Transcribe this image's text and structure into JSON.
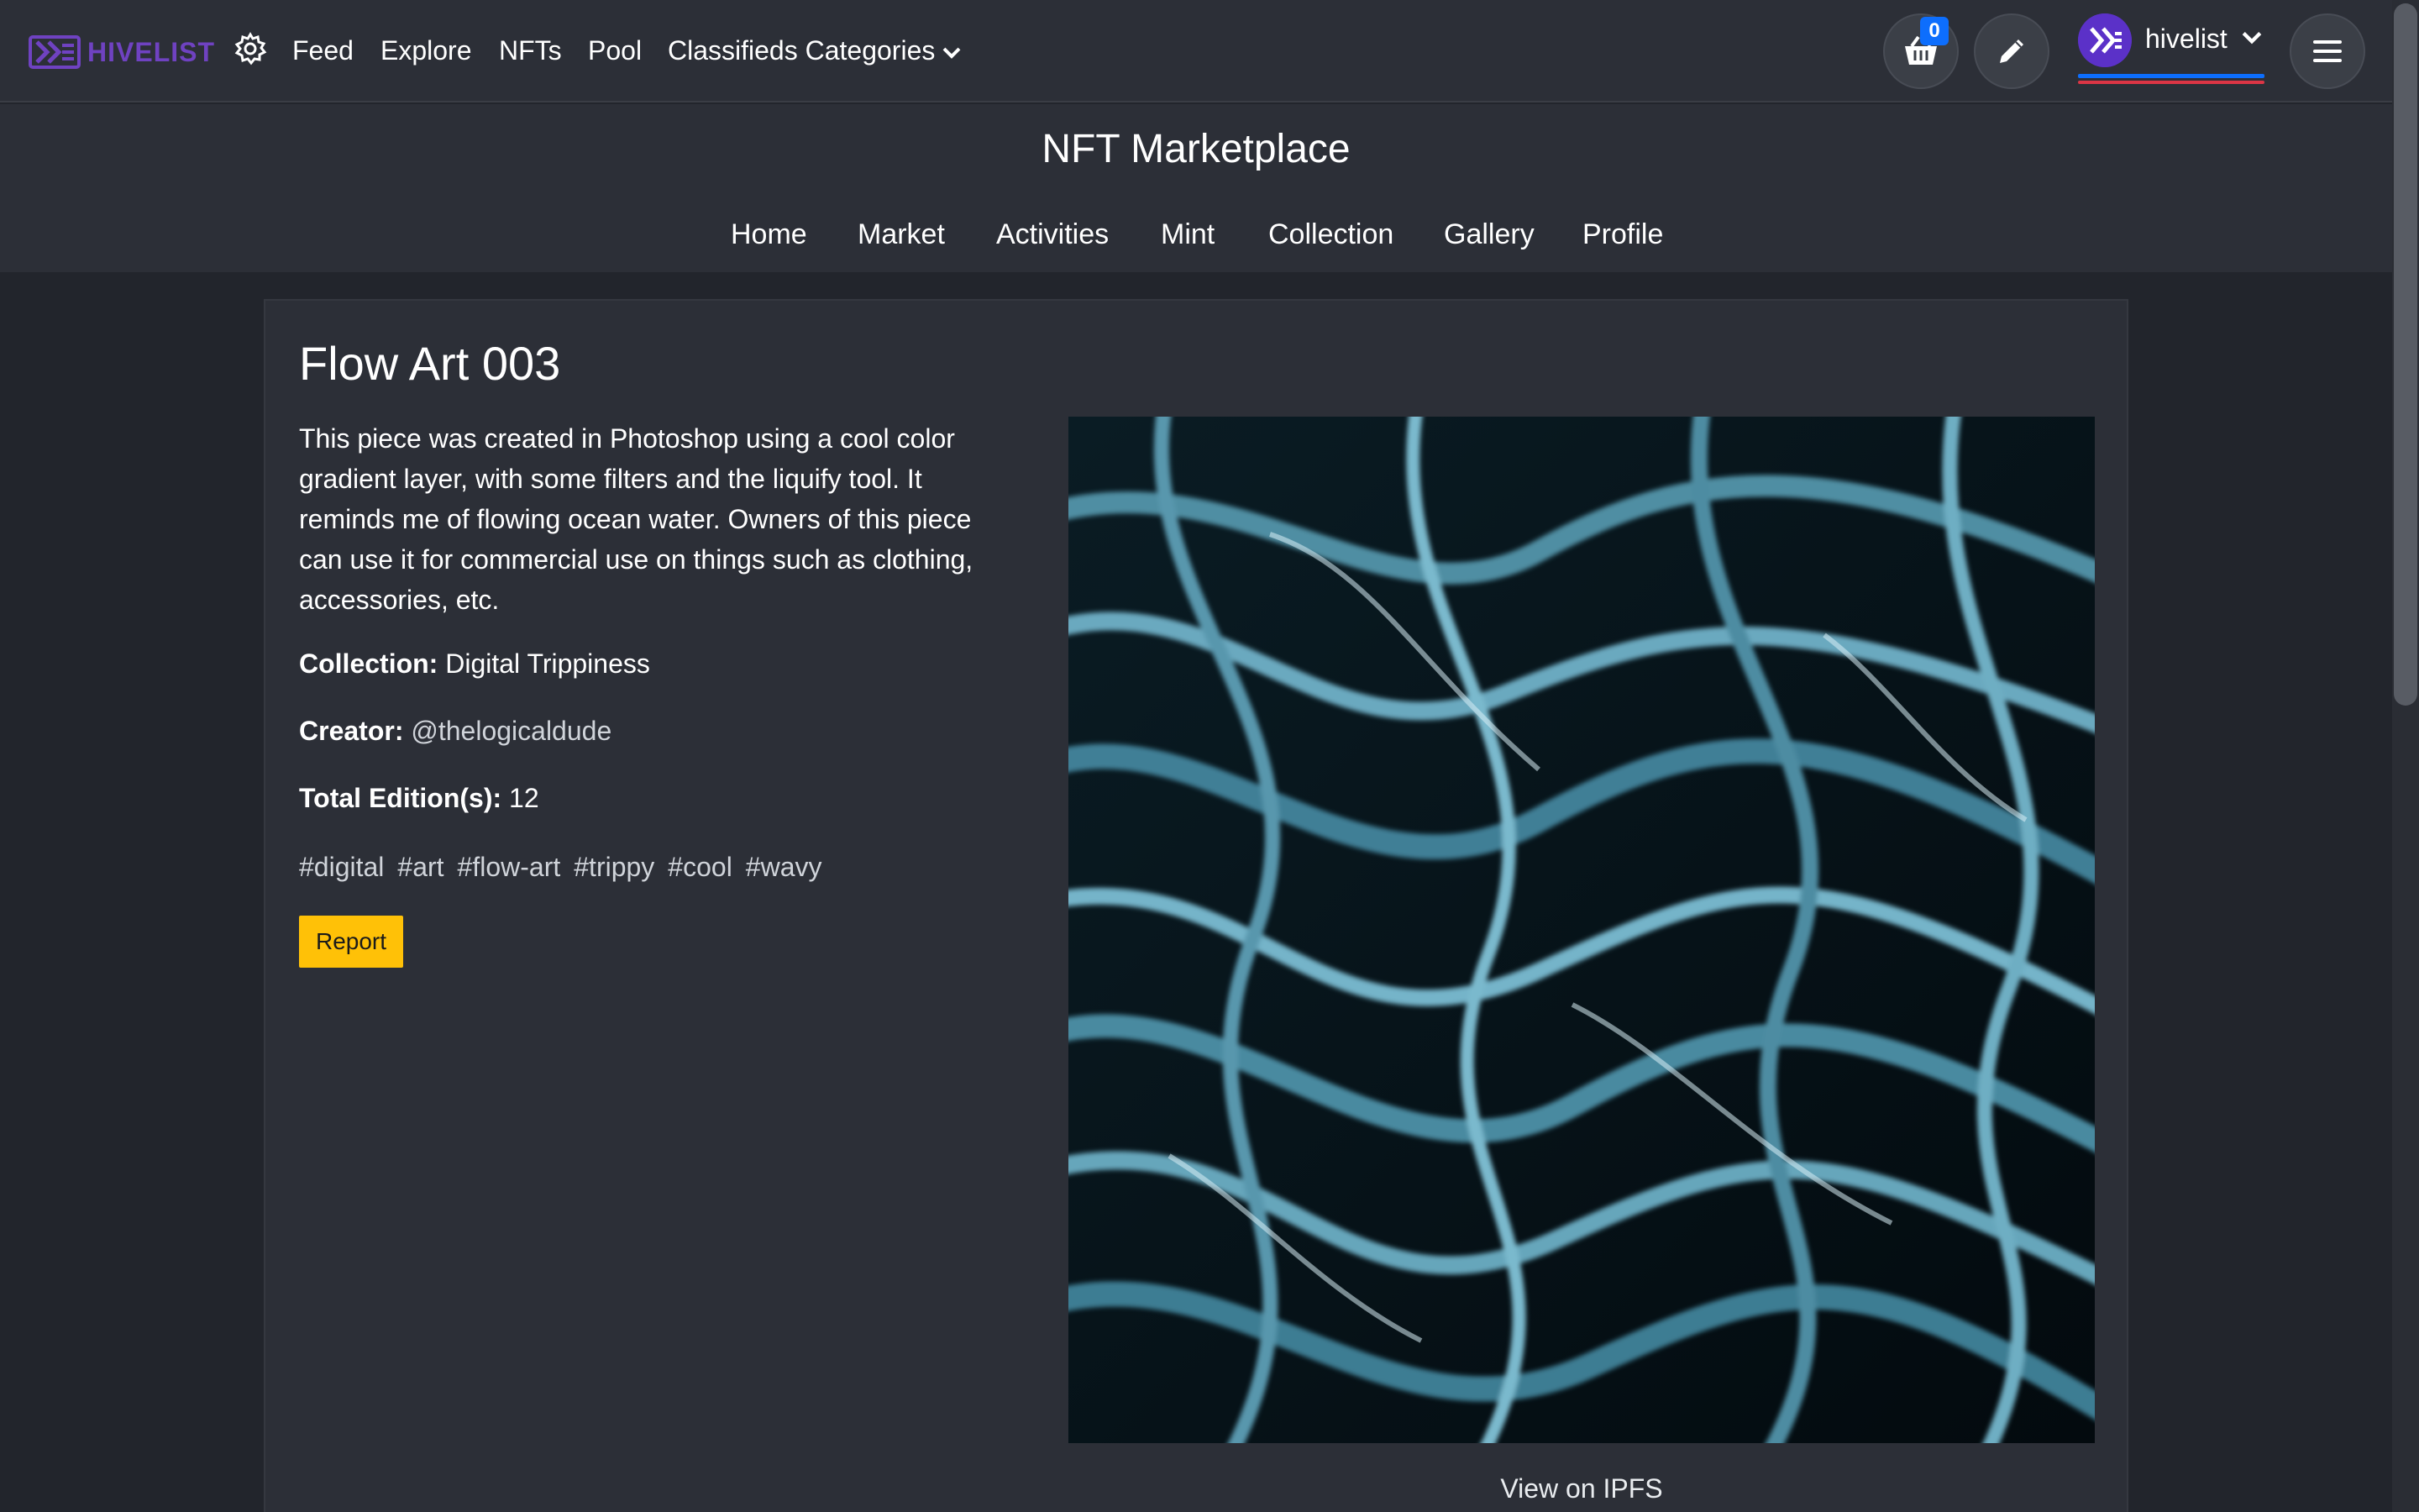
{
  "brand": {
    "name": "HIVELIST",
    "color": "#6f42c1"
  },
  "topnav": {
    "settings_icon": "gear-icon",
    "links": [
      "Feed",
      "Explore",
      "NFTs",
      "Pool"
    ],
    "categories_label": "Classifieds Categories",
    "cart_count": "0",
    "username": "hivelist"
  },
  "subheader": {
    "title": "NFT Marketplace",
    "tabs": [
      "Home",
      "Market",
      "Activities",
      "Mint",
      "Collection",
      "Gallery",
      "Profile"
    ]
  },
  "nft": {
    "title": "Flow Art 003",
    "description": "This piece was created in Photoshop using a cool color gradient layer, with some filters and the liquify tool. It reminds me of flowing ocean water. Owners of this piece can use it for commercial use on things such as clothing, accessories, etc.",
    "collection_label": "Collection:",
    "collection_value": "Digital Trippiness",
    "creator_label": "Creator:",
    "creator_value": "@thelogicaldude",
    "editions_label": "Total Edition(s):",
    "editions_value": "12",
    "tags": [
      "#digital",
      "#art",
      "#flow-art",
      "#trippy",
      "#cool",
      "#wavy"
    ],
    "report_label": "Report",
    "ipfs_label": "View on IPFS"
  },
  "colors": {
    "background": "#22252c",
    "panel": "#2c2f37",
    "report_button": "#ffc107",
    "badge": "#0d6efd",
    "underline_blue": "#0d6efd",
    "underline_red": "#dc3545"
  }
}
